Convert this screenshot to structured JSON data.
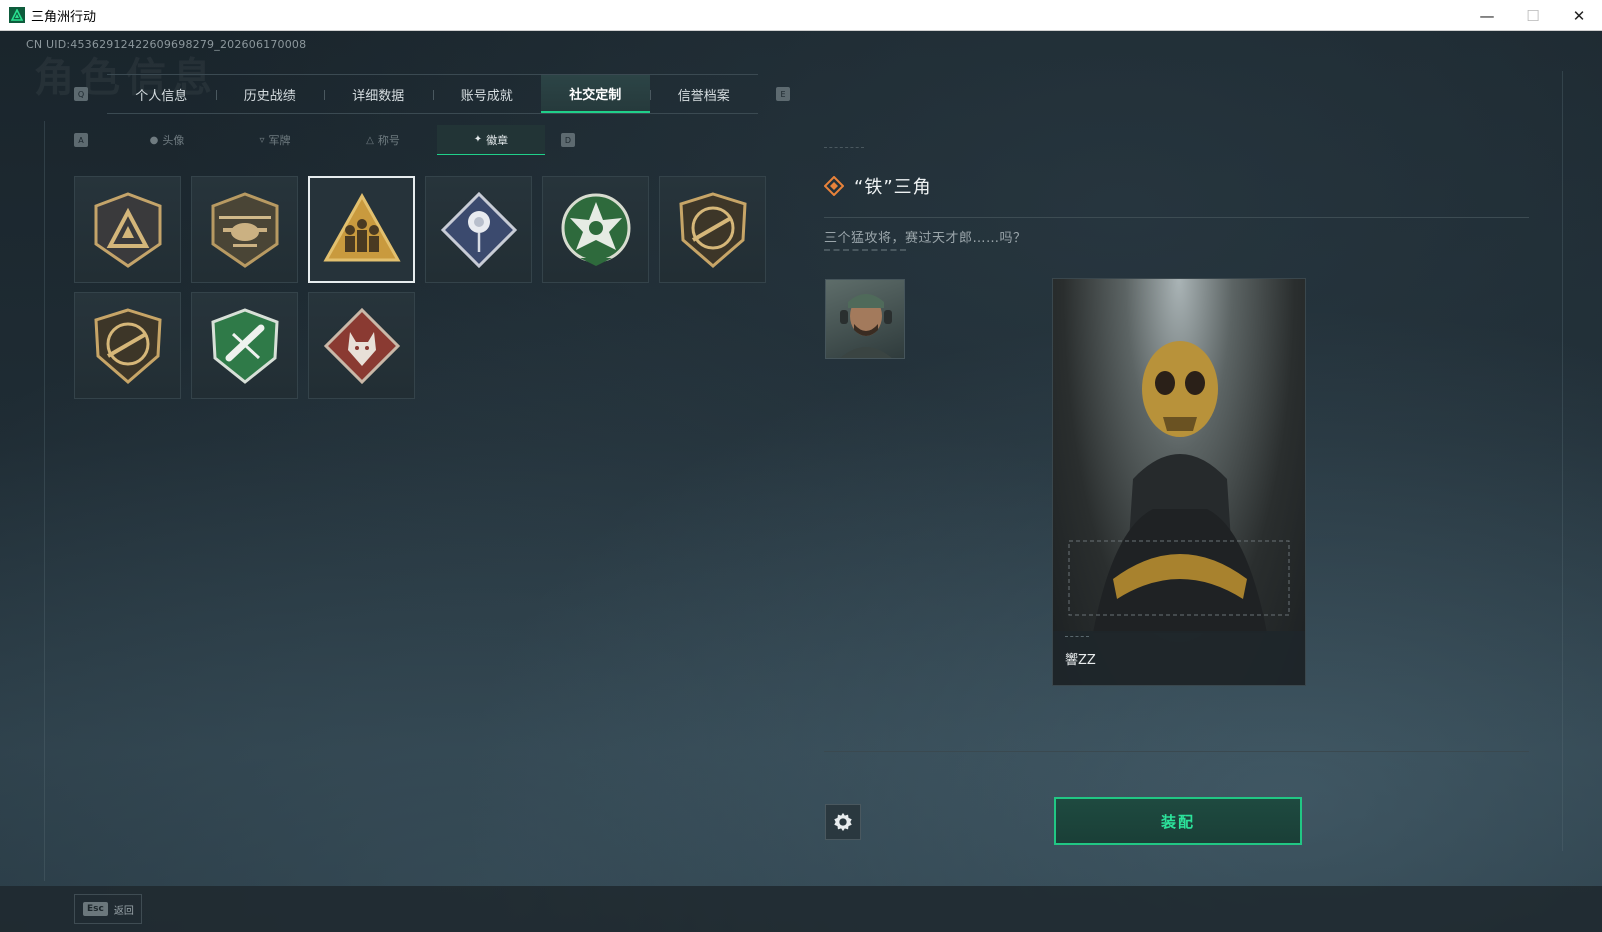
{
  "window": {
    "title": "三角洲行动",
    "controls": [
      "—",
      "☐",
      "✕"
    ]
  },
  "uid": "CN UID:45362912422609698279_202606170008",
  "background_title": "角色信息",
  "main_tabs": {
    "prev_key": "Q",
    "next_key": "E",
    "items": [
      {
        "label": "个人信息",
        "active": false
      },
      {
        "label": "历史战绩",
        "active": false
      },
      {
        "label": "详细数据",
        "active": false
      },
      {
        "label": "账号成就",
        "active": false
      },
      {
        "label": "社交定制",
        "active": true
      },
      {
        "label": "信誉档案",
        "active": false
      }
    ]
  },
  "sub_tabs": {
    "prev_key": "A",
    "next_key": "D",
    "items": [
      {
        "label": "头像",
        "icon": "person-icon",
        "active": false
      },
      {
        "label": "军牌",
        "icon": "tag-icon",
        "active": false
      },
      {
        "label": "称号",
        "icon": "triangle-icon",
        "active": false
      },
      {
        "label": "徽章",
        "icon": "badge-wings-icon",
        "active": true
      }
    ]
  },
  "badges": [
    {
      "icon": "delta-shield-badge-icon",
      "selected": false
    },
    {
      "icon": "helicopter-badge-icon",
      "selected": false
    },
    {
      "icon": "soldiers-triangle-badge-icon",
      "selected": true
    },
    {
      "icon": "rose-diamond-badge-icon",
      "selected": false
    },
    {
      "icon": "green-star-badge-icon",
      "selected": false
    },
    {
      "icon": "rifle-shield-badge-icon",
      "selected": false
    },
    {
      "icon": "rifle-shield-badge-icon",
      "selected": false
    },
    {
      "icon": "green-missile-badge-icon",
      "selected": false
    },
    {
      "icon": "wolf-diamond-badge-icon",
      "selected": false
    }
  ],
  "detail": {
    "title": "“铁”三角",
    "description": "三个猛攻将，赛过天才郎……吗？",
    "card_name": "響ZZ"
  },
  "buttons": {
    "equip": "装配"
  },
  "footer": {
    "esc_key": "Esc",
    "esc_label": "返回"
  },
  "colors": {
    "accent": "#20d08a",
    "panel": "#27343b",
    "background": "#1b262d"
  }
}
